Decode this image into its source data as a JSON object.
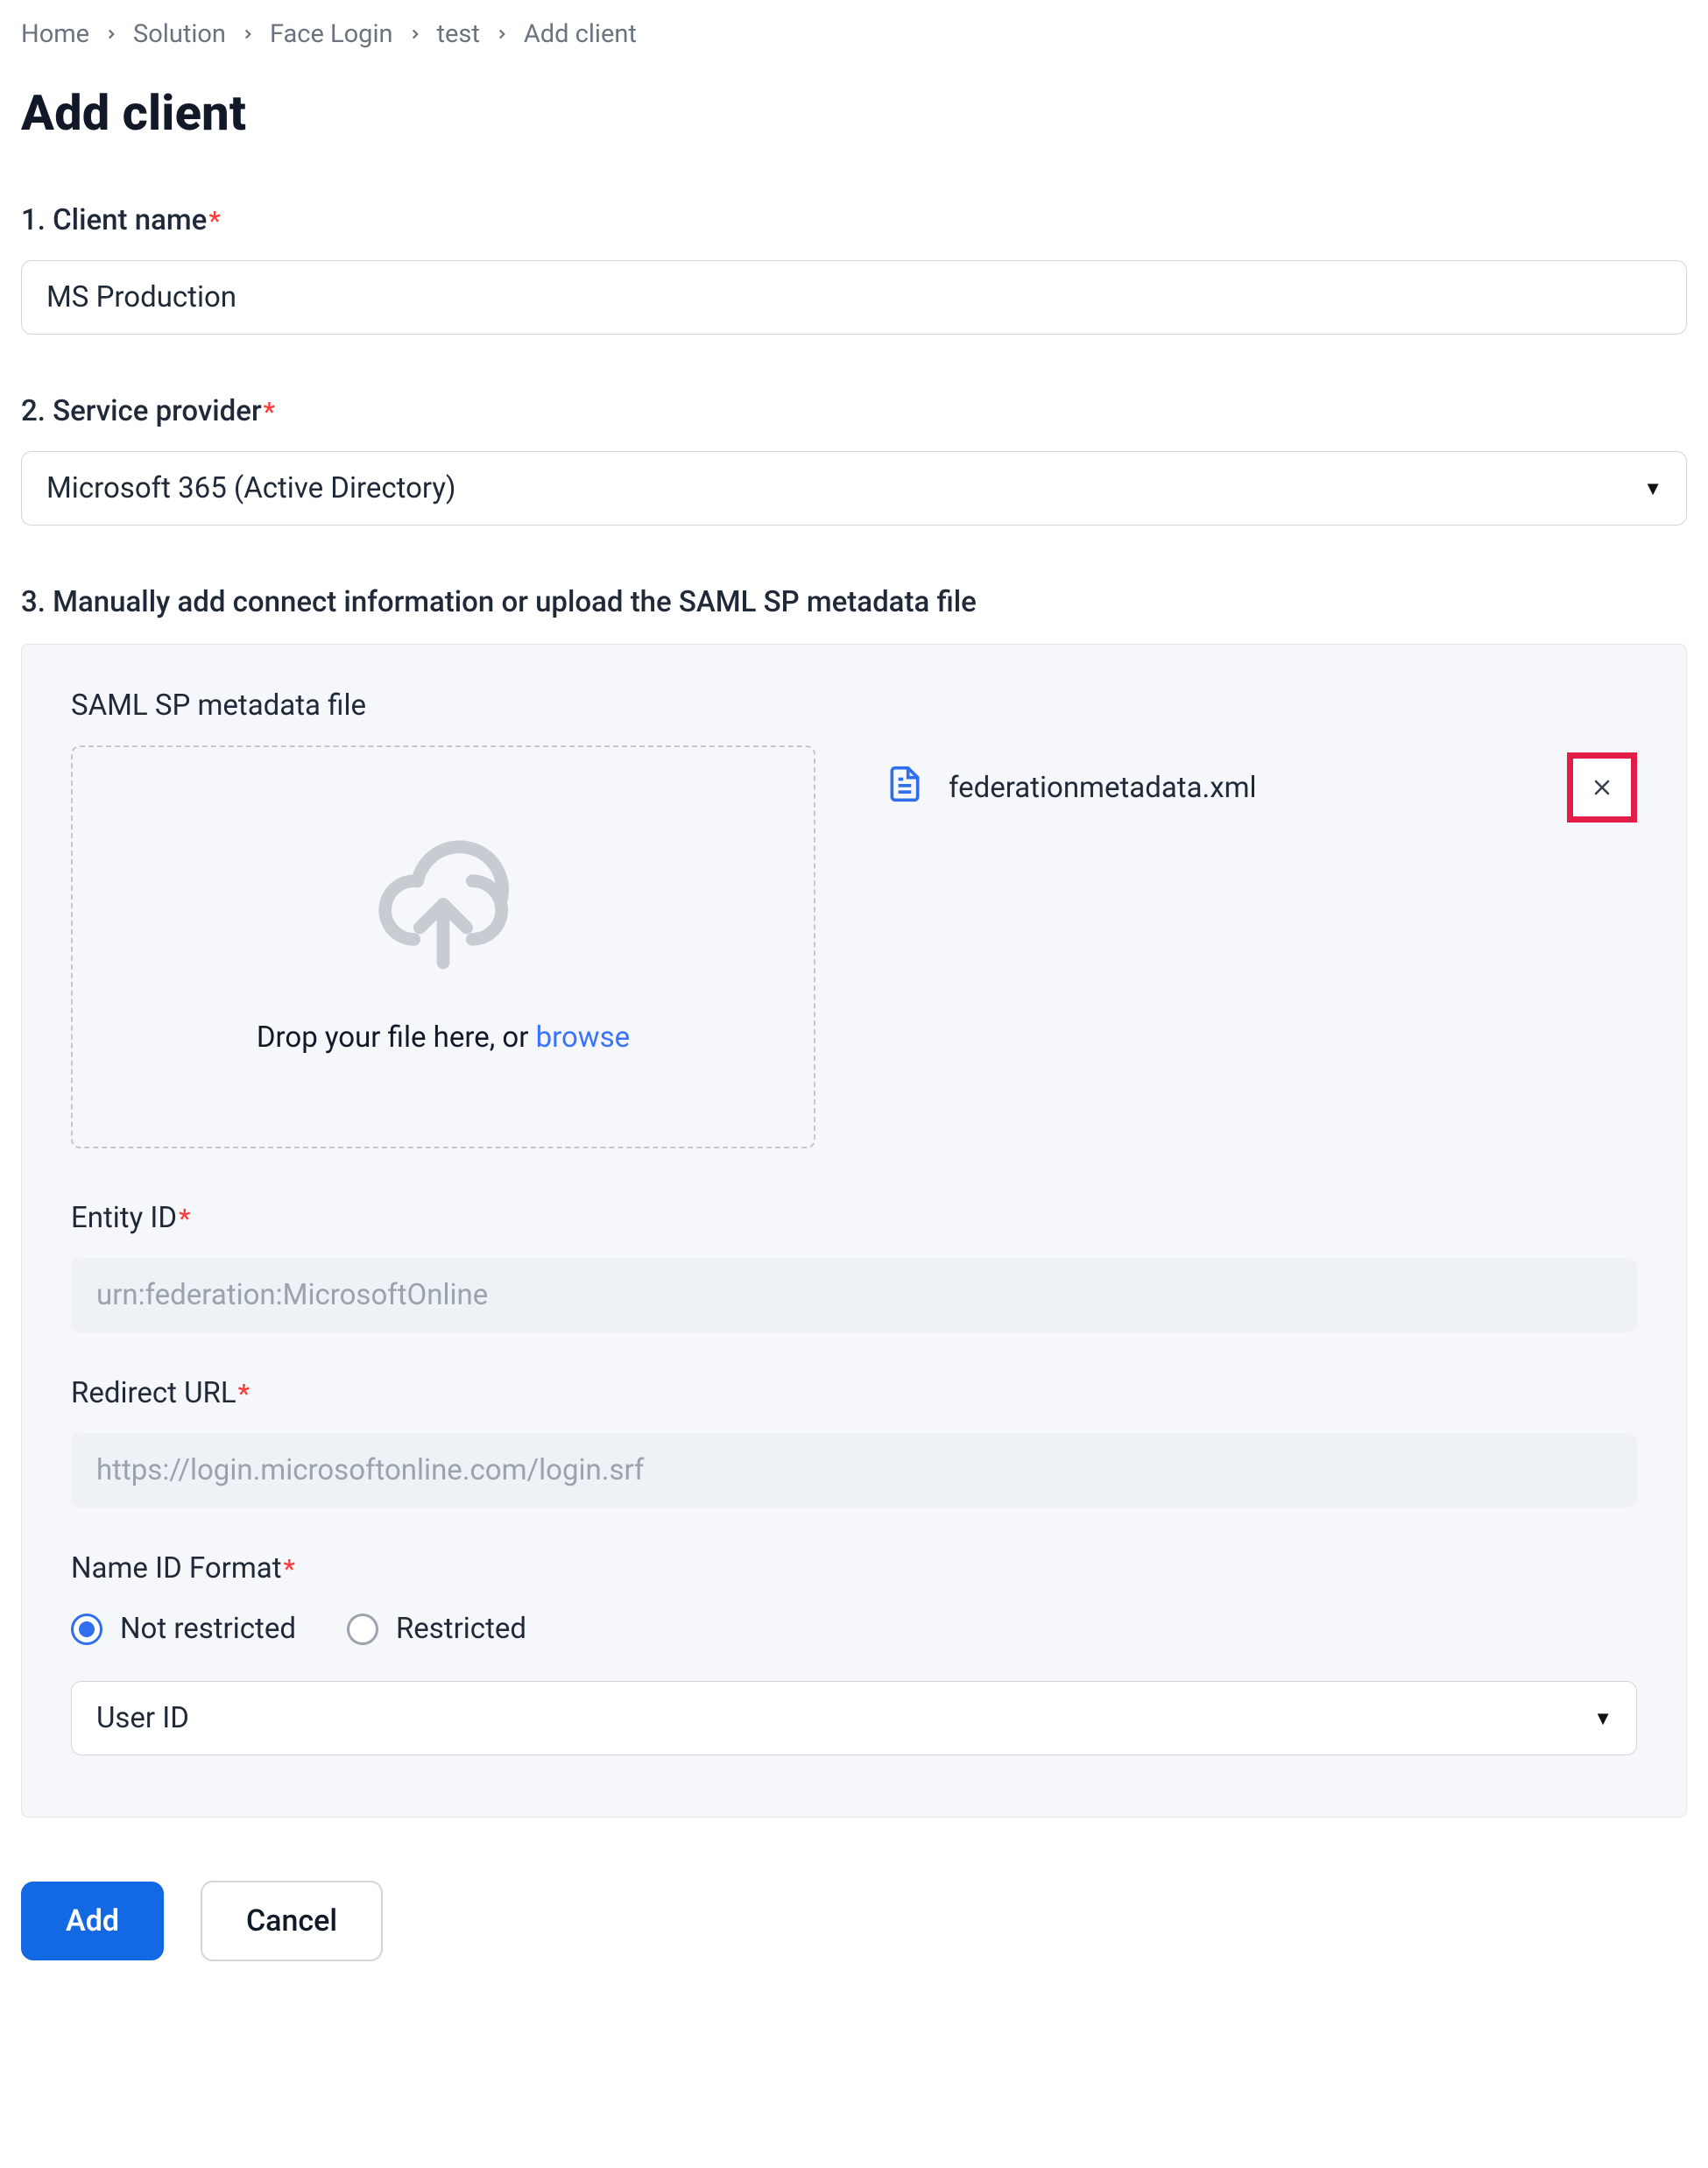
{
  "breadcrumb": {
    "items": [
      {
        "label": "Home"
      },
      {
        "label": "Solution"
      },
      {
        "label": "Face Login"
      },
      {
        "label": "test"
      },
      {
        "label": "Add client"
      }
    ]
  },
  "page_title": "Add client",
  "step1": {
    "label": "1. Client name",
    "value": "MS Production"
  },
  "step2": {
    "label": "2. Service provider",
    "value": "Microsoft 365 (Active Directory)"
  },
  "step3": {
    "label": "3. Manually add connect information or upload the SAML SP metadata file"
  },
  "upload": {
    "section_label": "SAML SP metadata file",
    "hint_prefix": "Drop your file here, or ",
    "browse": "browse",
    "file_name": "federationmetadata.xml"
  },
  "entity_id": {
    "label": "Entity ID",
    "value": "urn:federation:MicrosoftOnline"
  },
  "redirect_url": {
    "label": "Redirect URL",
    "value": "https://login.microsoftonline.com/login.srf"
  },
  "name_id": {
    "label": "Name ID Format",
    "option_not_restricted": "Not restricted",
    "option_restricted": "Restricted",
    "select_value": "User ID"
  },
  "buttons": {
    "add": "Add",
    "cancel": "Cancel"
  },
  "required_marker": "*"
}
